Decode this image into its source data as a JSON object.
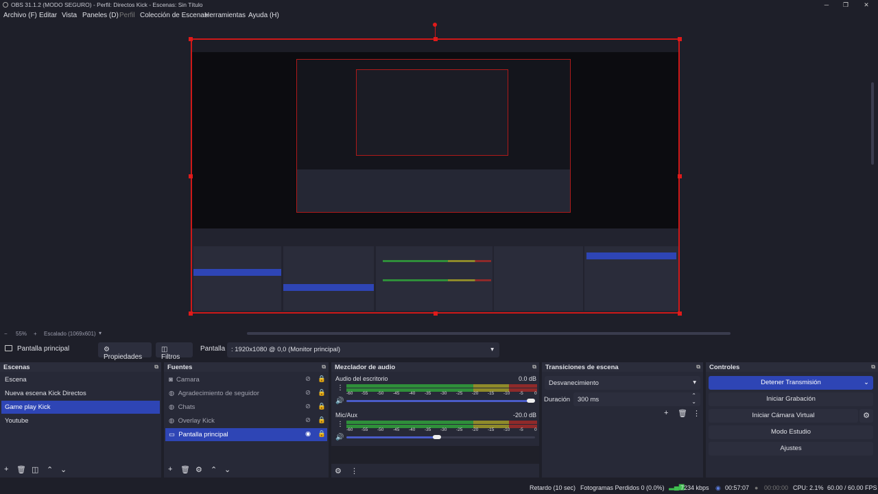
{
  "window": {
    "title": "OBS 31.1.2 (MODO SEGURO) - Perfil: Directos Kick - Escenas: Sin Título"
  },
  "menu": [
    "Archivo (F)",
    "Editar",
    "Vista",
    "Paneles (D)",
    "Perfil",
    "Colección de Escenas",
    "Herramientas",
    "Ayuda (H)"
  ],
  "zoom": {
    "minus": "−",
    "percent": "55%",
    "plus": "+",
    "scaled": "Escalado (1069x601)"
  },
  "source_toolbar": {
    "current_source": "Pantalla principal",
    "properties": "Propiedades",
    "filters": "Filtros",
    "display_label": "Pantalla",
    "display_value": ": 1920x1080 @ 0,0 (Monitor principal)"
  },
  "scenes": {
    "title": "Escenas",
    "items": [
      "Escena",
      "Nueva escena Kick Directos",
      "Game play Kick",
      "Youtube"
    ],
    "selected": 2
  },
  "sources": {
    "title": "Fuentes",
    "items": [
      {
        "name": "Camara",
        "icon": "camera-icon"
      },
      {
        "name": "Agradecimiento de seguidor",
        "icon": "browser-icon"
      },
      {
        "name": "Chats",
        "icon": "browser-icon"
      },
      {
        "name": "Overlay Kick",
        "icon": "browser-icon"
      },
      {
        "name": "Pantalla principal",
        "icon": "monitor-icon"
      }
    ],
    "selected": 4
  },
  "mixer": {
    "title": "Mezclador de audio",
    "channels": [
      {
        "name": "Audio del escritorio",
        "db": "0.0 dB",
        "level": 1.0
      },
      {
        "name": "Mic/Aux",
        "db": "-20.0 dB",
        "level": 0.48
      }
    ],
    "ticks": [
      "-60",
      "-55",
      "-50",
      "-45",
      "-40",
      "-35",
      "-30",
      "-25",
      "-20",
      "-15",
      "-10",
      "-5",
      "0"
    ]
  },
  "transitions": {
    "title": "Transiciones de escena",
    "selected": "Desvanecimiento",
    "duration_label": "Duración",
    "duration_value": "300 ms"
  },
  "controls": {
    "title": "Controles",
    "buttons": [
      "Detener Transmisión",
      "Iniciar Grabación",
      "Iniciar Cámara Virtual",
      "Modo Estudio",
      "Ajustes"
    ]
  },
  "status": {
    "delay": "Retardo (10 sec)",
    "dropped": "Fotogramas Perdidos 0 (0.0%)",
    "bitrate": "7234 kbps",
    "stream_time": "00:57:07",
    "rec_time": "00:00:00",
    "cpu": "CPU: 2.1%",
    "fps": "60.00 / 60.00 FPS"
  },
  "colors": {
    "accent": "#2e45b5",
    "selection_border": "#d01818",
    "meter_green": "#2f8f3a",
    "meter_yellow": "#8f8a2a",
    "meter_red": "#8f2a2a"
  }
}
